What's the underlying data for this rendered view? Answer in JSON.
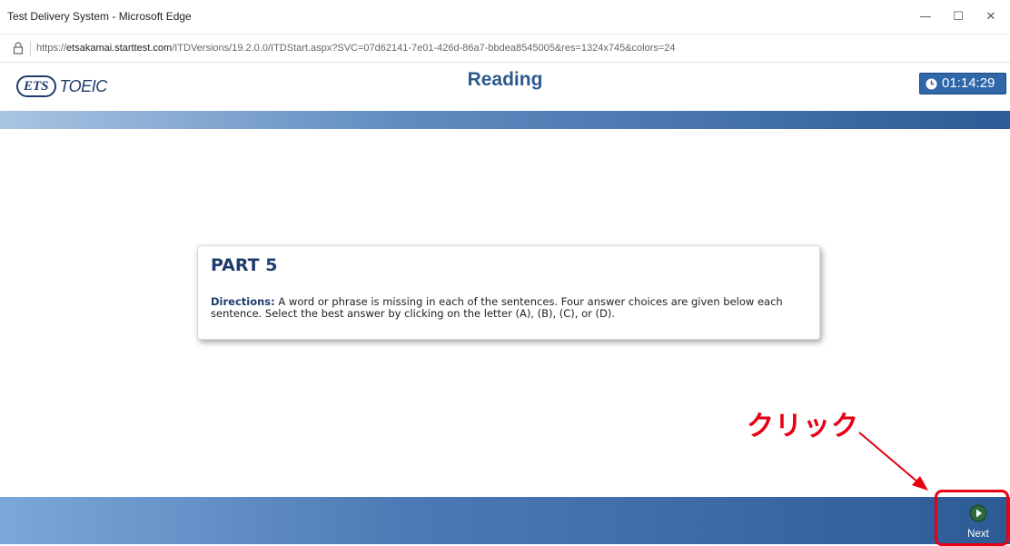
{
  "window": {
    "title": "Test Delivery System - Microsoft Edge",
    "controls": {
      "minimize": "—",
      "maximize": "☐",
      "close": "✕"
    }
  },
  "address_bar": {
    "url_prefix": "https://",
    "url_host": "etsakamai.starttest.com",
    "url_path": "/ITDVersions/19.2.0.0/ITDStart.aspx?SVC=07d62141-7e01-426d-86a7-bbdea8545005&res=1324x745&colors=24",
    "lock_icon": "lock-icon"
  },
  "header": {
    "logo_mark": "ETS",
    "logo_text": "TOEIC",
    "section_title": "Reading",
    "timer": "01:14:29"
  },
  "content": {
    "part_title": "PART 5",
    "directions_lead": "Directions:",
    "directions_text": " A word or phrase is missing in each of the sentences. Four answer choices are given below each sentence. Select the best answer by clicking on the letter (A), (B), (C), or (D)."
  },
  "annotation": {
    "label": "クリック",
    "color": "#e60012"
  },
  "footer": {
    "next_label": "Next"
  },
  "colors": {
    "brand": "#1f3b6e",
    "title": "#2d5a8e",
    "timer_bg": "#2f67a8",
    "highlight": "#e60012"
  }
}
